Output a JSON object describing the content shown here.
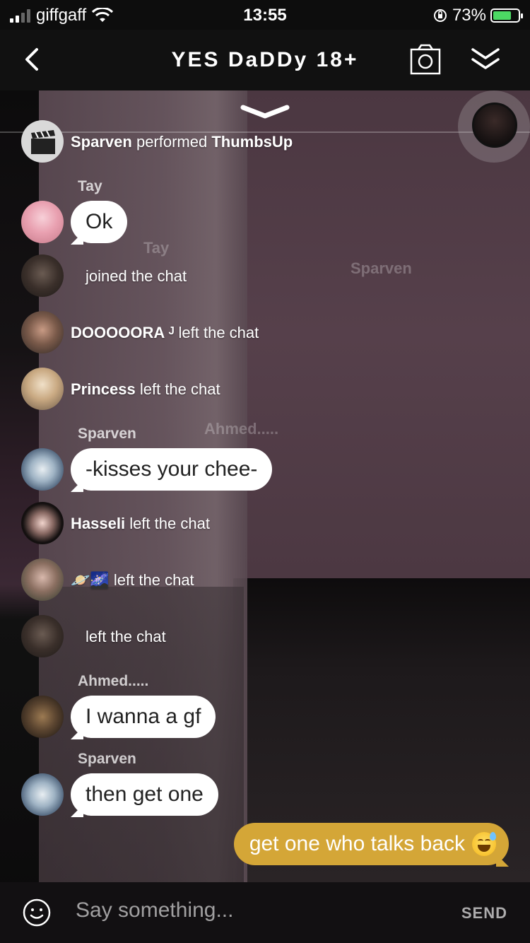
{
  "status_bar": {
    "carrier": "giffgaff",
    "time": "13:55",
    "battery_percent": "73%",
    "battery_level": 0.73
  },
  "header": {
    "title": "YES DaDDy 18+",
    "back_icon": "chevron-left-icon",
    "camera_icon": "camera-icon",
    "collapse_icon": "double-chevron-down-icon"
  },
  "ghost_labels": [
    "Tay",
    "Sparven",
    "Ahmed....."
  ],
  "messages": [
    {
      "type": "system",
      "user": "Sparven",
      "text": "performed",
      "action": "ThumbsUp"
    },
    {
      "type": "chat",
      "sender": "Tay",
      "text": "Ok"
    },
    {
      "type": "system",
      "user": "",
      "text": "joined the chat"
    },
    {
      "type": "system",
      "user": "DOOOOORA ᴶ",
      "text": "left the chat"
    },
    {
      "type": "system",
      "user": "Princess",
      "text": "left the chat"
    },
    {
      "type": "chat",
      "sender": "Sparven",
      "text": "-kisses your chee-"
    },
    {
      "type": "system",
      "user": "Hasseli",
      "text": "left the chat"
    },
    {
      "type": "system",
      "user": "🪐🌌",
      "text": "left the chat"
    },
    {
      "type": "system",
      "user": "",
      "text": "left the chat"
    },
    {
      "type": "chat",
      "sender": "Ahmed.....",
      "text": "I wanna a gf"
    },
    {
      "type": "chat",
      "sender": "Sparven",
      "text": "then get one"
    }
  ],
  "my_message": {
    "text": "get one who talks back",
    "emoji": "grinning-sweat-emoji"
  },
  "composer": {
    "placeholder": "Say something...",
    "send_label": "SEND",
    "emoji_icon": "smiley-icon"
  }
}
